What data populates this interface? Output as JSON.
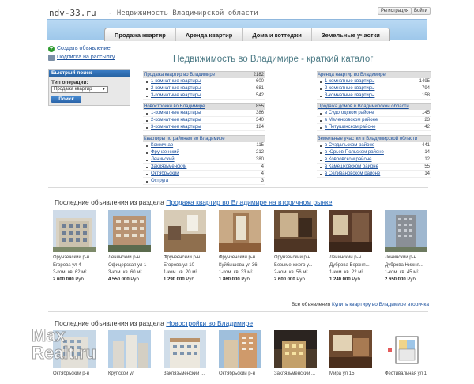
{
  "header": {
    "site_name": "ndv-33.ru",
    "site_subtitle": "- Недвижимость Владимирской области",
    "register_label": "Регистрация",
    "login_label": "Войти"
  },
  "nav": {
    "tabs": [
      {
        "label": "Продажа квартир"
      },
      {
        "label": "Аренда квартир"
      },
      {
        "label": "Дома и коттеджи"
      },
      {
        "label": "Земельные участки"
      }
    ]
  },
  "sidebar": {
    "add_listing": "Создать объявление",
    "subscribe": "Подписка на рассылку",
    "search": {
      "title": "Быстрый поиск",
      "operation_label": "Тип операции:",
      "operation_value": "Продажа квартир",
      "button": "Поиск"
    }
  },
  "main_title": "Недвижимость во Владимире - краткий каталог",
  "catalog": {
    "sale": {
      "title": "Продажа квартир во Владимире",
      "count": "2182",
      "items": [
        {
          "label": "1-комнатные квартиры",
          "count": "600"
        },
        {
          "label": "2-комнатные квартиры",
          "count": "681"
        },
        {
          "label": "3-комнатные квартиры",
          "count": "542"
        }
      ]
    },
    "new": {
      "title": "Новостройки во Владимире",
      "count": "855",
      "items": [
        {
          "label": "1-комнатные квартиры",
          "count": "386"
        },
        {
          "label": "2-комнатные квартиры",
          "count": "340"
        },
        {
          "label": "3-комнатные квартиры",
          "count": "124"
        }
      ]
    },
    "districts": {
      "title": "Квартиры по районам во Владимире",
      "count": "",
      "items": [
        {
          "label": "Коммунар",
          "count": "115"
        },
        {
          "label": "Фрунзенский",
          "count": "212"
        },
        {
          "label": "Ленинский",
          "count": "380"
        },
        {
          "label": "Заклязьменский",
          "count": "4"
        },
        {
          "label": "Октябрьский",
          "count": "4"
        },
        {
          "label": "Оструга",
          "count": "3"
        }
      ]
    },
    "rent": {
      "title": "Аренда квартир во Владимире",
      "count": "",
      "items": [
        {
          "label": "1-комнатные квартиры",
          "count": "1495"
        },
        {
          "label": "2-комнатные квартиры",
          "count": "794"
        },
        {
          "label": "3-комнатные квартиры",
          "count": "158"
        }
      ]
    },
    "houses": {
      "title": "Продажа домов в Владимирской области",
      "count": "",
      "items": [
        {
          "label": "в Судогодском районе",
          "count": "145"
        },
        {
          "label": "в Меленковском районе",
          "count": "23"
        },
        {
          "label": "в Петушинском районе",
          "count": "42"
        }
      ]
    },
    "land": {
      "title": "Земельные участки в Владимирской области",
      "count": "",
      "items": [
        {
          "label": "в Суздальском районе",
          "count": "441"
        },
        {
          "label": "в Юрьев-Польском районе",
          "count": "14"
        },
        {
          "label": "в Ковровском районе",
          "count": "12"
        },
        {
          "label": "в Камешковском районе",
          "count": "55"
        },
        {
          "label": "в Селивановском районе",
          "count": "14"
        }
      ]
    }
  },
  "section1": {
    "prefix": "Последние объявления из раздела",
    "link": "Продажа квартир во Владимире на вторичном рынке",
    "all_label": "Все объявления",
    "all_link": "Купить квартиру во Владимире вторичка",
    "currency": "Руб",
    "listings": [
      {
        "district": "Фрунзенский р-н",
        "address": "Егорова ул 4",
        "info": "3-ком. кв. 62 м²",
        "price": "2 600 000"
      },
      {
        "district": "Ленинский р-н",
        "address": "Офицерская ул 1",
        "info": "3-ком. кв. 60 м²",
        "price": "4 550 000"
      },
      {
        "district": "Фрунзенский р-н",
        "address": "Егорова ул 10",
        "info": "1-ком. кв. 20 м²",
        "price": "1 290 000"
      },
      {
        "district": "Фрунзенский р-н",
        "address": "Куйбышева ул 36",
        "info": "1-ком. кв. 33 м²",
        "price": "1 860 000"
      },
      {
        "district": "Фрунзенский р-н",
        "address": "Безыменского у...",
        "info": "2-ком. кв. 56 м²",
        "price": "2 600 000"
      },
      {
        "district": "Ленинский р-н",
        "address": "Дуброва Верхня...",
        "info": "1-ком. кв. 22 м²",
        "price": "1 240 000"
      },
      {
        "district": "Ленинский р-н",
        "address": "Дуброва Нижня...",
        "info": "1-ком. кв. 45 м²",
        "price": "2 650 000"
      }
    ]
  },
  "section2": {
    "prefix": "Последние объявления из раздела",
    "link": "Новостройки во Владимире",
    "listings": [
      {
        "district": "Октябрьский р-н"
      },
      {
        "district": "Крупской ул"
      },
      {
        "district": "Заклязьменский ..."
      },
      {
        "district": "Октябрьский р-н"
      },
      {
        "district": "Заклязьменский ..."
      },
      {
        "district": "Мира ул 15"
      },
      {
        "district": "Фестивальная ул 1"
      }
    ]
  },
  "watermark": {
    "line1": "Max",
    "line2": "Realt.ru"
  }
}
